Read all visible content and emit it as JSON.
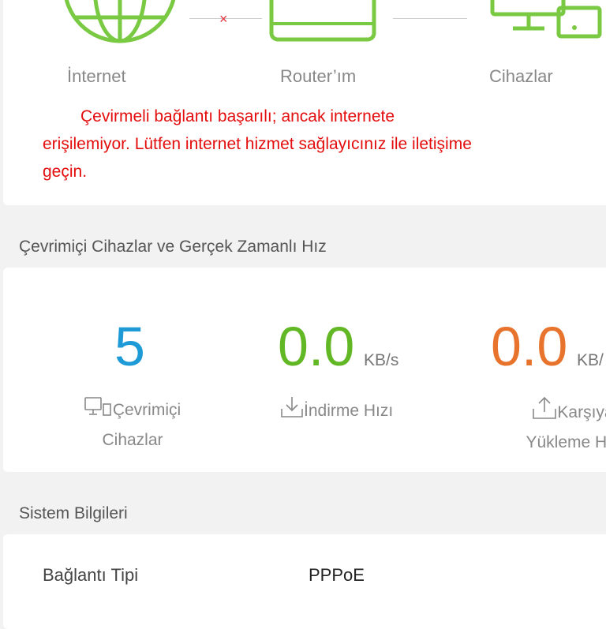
{
  "topology": {
    "nodes": [
      {
        "label": "İnternet",
        "icon": "globe-icon"
      },
      {
        "label": "Router’ım",
        "icon": "router-icon"
      },
      {
        "label": "Cihazlar",
        "icon": "devices-icon"
      }
    ],
    "connection_status": "×",
    "error_message": "Çevirmeli bağlantı başarılı; ancak internete erişilemiyor. Lütfen internet hizmet sağlayıcınız ile iletişime geçin.",
    "colors": {
      "icon": "#7ac943",
      "error": "#e40d0d"
    }
  },
  "online_section": {
    "title": "Çevrimiçi Cihazlar ve Gerçek Zamanlı Hız",
    "stats": [
      {
        "value": "5",
        "unit": "",
        "label_line1": "Çevrimiçi",
        "label_line2": "Cihazlar",
        "color": "#1e9bd7",
        "icon": "monitor-icon"
      },
      {
        "value": "0.0",
        "unit": "KB/s",
        "label_line1": "İndirme Hızı",
        "label_line2": "",
        "color": "#62b725",
        "icon": "download-icon"
      },
      {
        "value": "0.0",
        "unit": "KB/",
        "label_line1": "Karşıya",
        "label_line2": "Yükleme Hız",
        "color": "#e8732c",
        "icon": "upload-icon"
      }
    ]
  },
  "system_section": {
    "title": "Sistem Bilgileri",
    "rows": [
      {
        "label": "Bağlantı Tipi",
        "value": "PPPoE"
      }
    ]
  }
}
